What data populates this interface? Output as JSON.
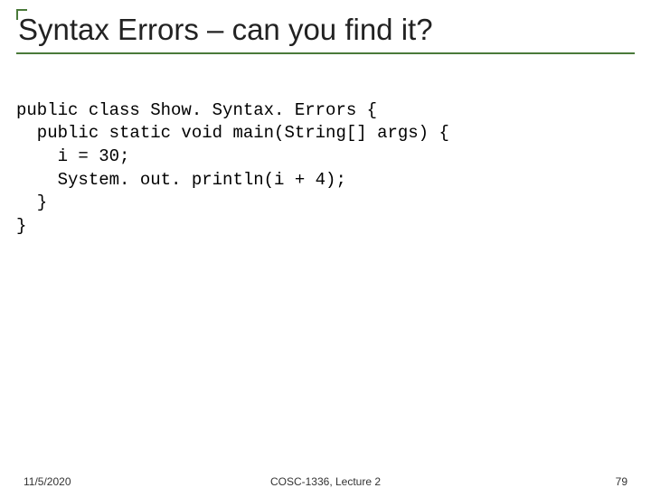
{
  "slide": {
    "title": "Syntax Errors – can you find it?",
    "code_lines": [
      "public class Show. Syntax. Errors {",
      "  public static void main(String[] args) {",
      "    i = 30;",
      "    System. out. println(i + 4);",
      "  }",
      "}"
    ],
    "footer": {
      "date": "11/5/2020",
      "course": "COSC-1336, Lecture 2",
      "page": "79"
    }
  }
}
